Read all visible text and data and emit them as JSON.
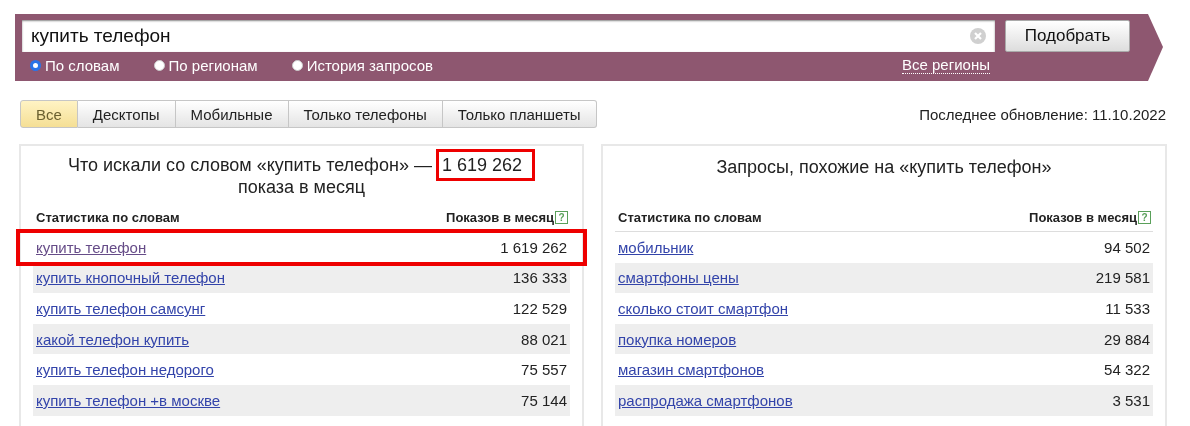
{
  "search": {
    "value": "купить телефон",
    "button": "Подобрать",
    "modes": [
      {
        "label": "По словам",
        "selected": true
      },
      {
        "label": "По регионам",
        "selected": false
      },
      {
        "label": "История запросов",
        "selected": false
      }
    ],
    "region_link": "Все регионы"
  },
  "tabs": [
    {
      "label": "Все",
      "selected": true
    },
    {
      "label": "Десктопы",
      "selected": false
    },
    {
      "label": "Мобильные",
      "selected": false
    },
    {
      "label": "Только телефоны",
      "selected": false
    },
    {
      "label": "Только планшеты",
      "selected": false
    }
  ],
  "last_update": "Последнее обновление: 11.10.2022",
  "left_panel": {
    "title": "Что искали со словом «купить телефон» —",
    "total": "1 619 262",
    "total_highlighted": true,
    "title_suffix": "показа в месяц",
    "columns": [
      "Статистика по словам",
      "Показов в месяц"
    ],
    "help": "?",
    "rows": [
      {
        "phrase": "купить телефон",
        "count": "1 619 262",
        "visited": true,
        "highlighted": true
      },
      {
        "phrase": "купить кнопочный телефон",
        "count": "136 333",
        "visited": false,
        "highlighted": false
      },
      {
        "phrase": "купить телефон самсунг",
        "count": "122 529",
        "visited": false,
        "highlighted": false
      },
      {
        "phrase": "какой телефон купить",
        "count": "88 021",
        "visited": false,
        "highlighted": false
      },
      {
        "phrase": "купить телефон недорого",
        "count": "75 557",
        "visited": false,
        "highlighted": false
      },
      {
        "phrase": "купить телефон +в москве",
        "count": "75 144",
        "visited": false,
        "highlighted": false
      }
    ]
  },
  "right_panel": {
    "title": "Запросы, похожие на «купить телефон»",
    "columns": [
      "Статистика по словам",
      "Показов в месяц"
    ],
    "help": "?",
    "rows": [
      {
        "phrase": "мобильник",
        "count": "94 502",
        "visited": false,
        "highlighted": false
      },
      {
        "phrase": "смартфоны цены",
        "count": "219 581",
        "visited": false,
        "highlighted": false
      },
      {
        "phrase": "сколько стоит смартфон",
        "count": "11 533",
        "visited": false,
        "highlighted": false
      },
      {
        "phrase": "покупка номеров",
        "count": "29 884",
        "visited": false,
        "highlighted": false
      },
      {
        "phrase": "магазин смартфонов",
        "count": "54 322",
        "visited": false,
        "highlighted": false
      },
      {
        "phrase": "распродажа смартфонов",
        "count": "3 531",
        "visited": false,
        "highlighted": false
      }
    ]
  }
}
